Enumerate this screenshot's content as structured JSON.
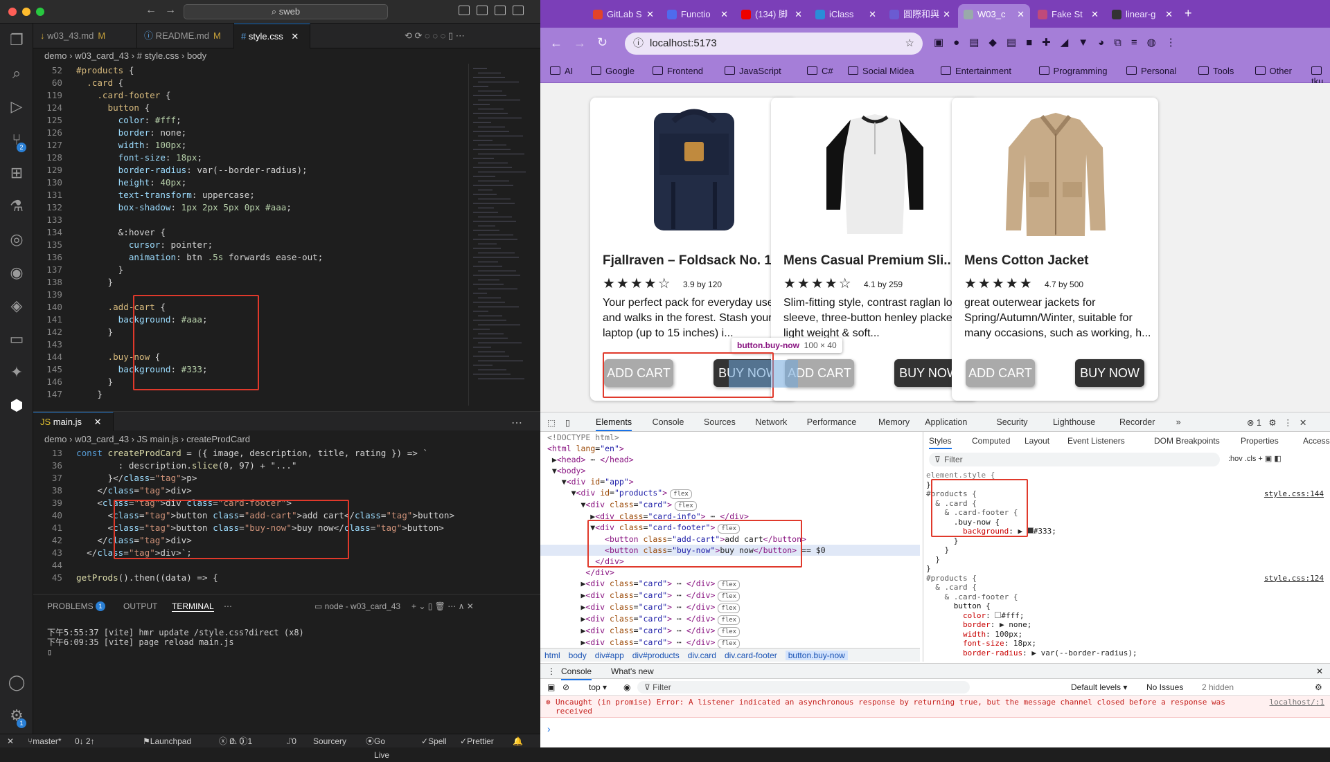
{
  "vscode": {
    "search": "sweb",
    "tabs": [
      {
        "label": "w03_43.md",
        "mark": "M"
      },
      {
        "label": "README.md",
        "mark": "M"
      },
      {
        "label": "style.css",
        "mark": ""
      }
    ],
    "breadcrumb1": [
      "demo",
      "w03_card_43",
      "#  style.css",
      "body"
    ],
    "css_lines": [
      [
        "52",
        "#products {"
      ],
      [
        "60",
        "  .card {"
      ],
      [
        "119",
        "    .card-footer {"
      ],
      [
        "124",
        "      button {"
      ],
      [
        "125",
        "        color: #fff;"
      ],
      [
        "126",
        "        border: none;"
      ],
      [
        "127",
        "        width: 100px;"
      ],
      [
        "128",
        "        font-size: 18px;"
      ],
      [
        "129",
        "        border-radius: var(--border-radius);"
      ],
      [
        "130",
        "        height: 40px;"
      ],
      [
        "131",
        "        text-transform: uppercase;"
      ],
      [
        "132",
        "        box-shadow: 1px 2px 5px 0px #aaa;"
      ],
      [
        "133",
        ""
      ],
      [
        "134",
        "        &:hover {"
      ],
      [
        "135",
        "          cursor: pointer;"
      ],
      [
        "136",
        "          animation: btn .5s forwards ease-out;"
      ],
      [
        "137",
        "        }"
      ],
      [
        "138",
        "      }"
      ],
      [
        "139",
        ""
      ],
      [
        "140",
        "      .add-cart {"
      ],
      [
        "141",
        "        background: #aaa;"
      ],
      [
        "142",
        "      }"
      ],
      [
        "143",
        ""
      ],
      [
        "144",
        "      .buy-now {"
      ],
      [
        "145",
        "        background: #333;"
      ],
      [
        "146",
        "      }"
      ],
      [
        "147",
        "    }"
      ]
    ],
    "js_tab": "main.js",
    "breadcrumb2": [
      "demo",
      "w03_card_43",
      "JS main.js",
      "createProdCard"
    ],
    "js_lines": [
      [
        "13",
        "const createProdCard = ({ image, description, title, rating }) => `"
      ],
      [
        "36",
        "        : description.slice(0, 97) + \"...\""
      ],
      [
        "37",
        "      }</p>"
      ],
      [
        "38",
        "    </div>"
      ],
      [
        "39",
        "    <div class=\"card-footer\">"
      ],
      [
        "40",
        "      <button class=\"add-cart\">add cart</button>"
      ],
      [
        "41",
        "      <button class=\"buy-now\">buy now</button>"
      ],
      [
        "42",
        "    </div>"
      ],
      [
        "43",
        "  </div>`;"
      ],
      [
        "44",
        ""
      ],
      [
        "45",
        "getProds().then((data) => {"
      ]
    ],
    "panel_tabs": [
      "PROBLEMS",
      "OUTPUT",
      "TERMINAL"
    ],
    "problems_count": "1",
    "terminal_name": "node - w03_card_43",
    "terminal": [
      "下午5:55:37 [vite] hmr update /style.css?direct (x8)",
      "下午6:09:35 [vite] page reload main.js"
    ],
    "status": {
      "branch": "master*",
      "sync": "0↓ 2↑",
      "launchpad": "Launchpad",
      "errors": "0",
      "warnings": "0",
      "info": "1",
      "ports": "0",
      "sourcery": "Sourcery",
      "golive": "Go Live",
      "spell": "Spell",
      "prettier": "Prettier"
    }
  },
  "chrome": {
    "tabs": [
      "GitLab S",
      "Functio",
      "(134) 脚",
      "iClass",
      "圓際和與",
      "W03_c",
      "Fake St",
      "linear-g"
    ],
    "url": "localhost:5173",
    "bookmarks": [
      "AI",
      "Google",
      "Frontend",
      "JavaScript",
      "C#",
      "Social Midea",
      "Entertainment",
      "Programming",
      "Personal",
      "Tools",
      "Other",
      "tku"
    ],
    "products": [
      {
        "title": "Fjallraven – Foldsack No. 1...",
        "rating": "3.9 by 120",
        "stars": "★★★★☆",
        "desc": "Your perfect pack for everyday use and walks in the forest. Stash your laptop (up to 15 inches) i...",
        "add": "add cart",
        "buy": "buy now"
      },
      {
        "title": "Mens Casual Premium Sli...",
        "rating": "4.1 by 259",
        "stars": "★★★★☆",
        "desc": "Slim-fitting style, contrast raglan long sleeve, three-button henley placket, light weight & soft...",
        "add": "add cart",
        "buy": "buy now"
      },
      {
        "title": "Mens Cotton Jacket",
        "rating": "4.7 by 500",
        "stars": "★★★★★",
        "desc": "great outerwear jackets for Spring/Autumn/Winter, suitable for many occasions, such as working, h...",
        "add": "add cart",
        "buy": "buy now"
      }
    ],
    "tooltip": {
      "selector": "button.buy-now",
      "size": "100 × 40"
    },
    "devtools": {
      "tabs": [
        "Elements",
        "Console",
        "Sources",
        "Network",
        "Performance",
        "Memory",
        "Application",
        "Security",
        "Lighthouse",
        "Recorder"
      ],
      "errors": "1",
      "style_tabs": [
        "Styles",
        "Computed",
        "Layout",
        "Event Listeners",
        "DOM Breakpoints",
        "Properties",
        "Accessibility"
      ],
      "filter": "Filter",
      "breadcrumb": [
        "html",
        "body",
        "div#app",
        "div#products",
        "div.card",
        "div.card-footer",
        "button.buy-now"
      ],
      "style_src1": "style.css:144",
      "style_src2": "style.css:124",
      "console_tabs": [
        "Console",
        "What's new"
      ],
      "console_top": "top",
      "default_levels": "Default levels",
      "no_issues": "No Issues",
      "hidden": "2 hidden",
      "error": "Uncaught (in promise) Error: A listener indicated an asynchronous response by returning true, but the message channel closed before a response was received",
      "error_src": "localhost/:1"
    }
  },
  "colors": {
    "accent": "#2a7fd4",
    "chrome_tab": "#7b3fb8",
    "highlight": "#e0392b",
    "add": "#aaa",
    "buy": "#333"
  }
}
